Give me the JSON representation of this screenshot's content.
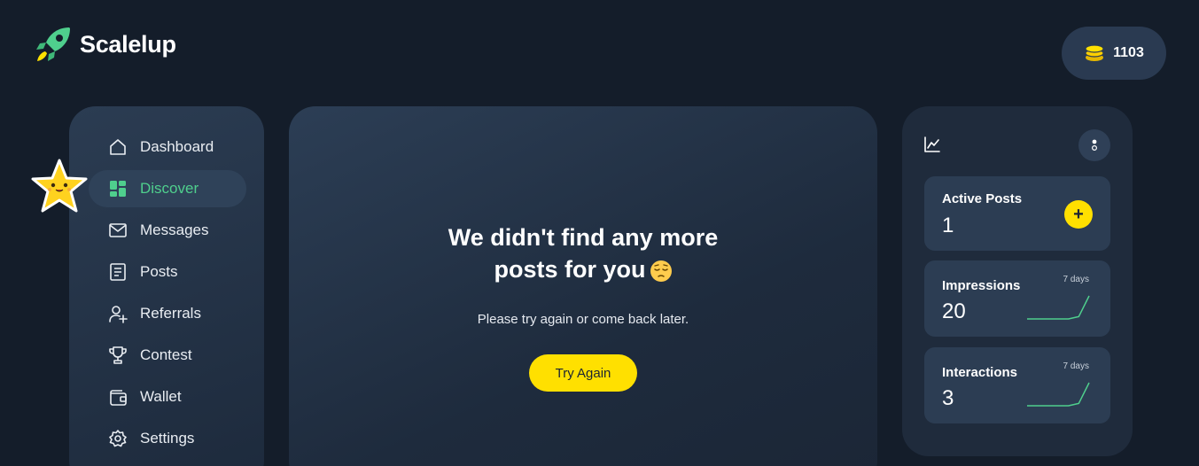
{
  "brand": {
    "name": "Scalelup",
    "logo_icon": "rocket-icon"
  },
  "coins": {
    "icon": "coins-icon",
    "value": "1103"
  },
  "sidebar": {
    "items": [
      {
        "label": "Dashboard",
        "icon": "home-icon",
        "active": false
      },
      {
        "label": "Discover",
        "icon": "dashboard-grid-icon",
        "active": true
      },
      {
        "label": "Messages",
        "icon": "mail-icon",
        "active": false
      },
      {
        "label": "Posts",
        "icon": "document-icon",
        "active": false
      },
      {
        "label": "Referrals",
        "icon": "user-plus-icon",
        "active": false
      },
      {
        "label": "Contest",
        "icon": "trophy-icon",
        "active": false
      },
      {
        "label": "Wallet",
        "icon": "wallet-icon",
        "active": false
      },
      {
        "label": "Settings",
        "icon": "gear-icon",
        "active": false
      }
    ]
  },
  "main": {
    "title_line1": "We didn't find any more",
    "title_line2": "posts for you",
    "title_emoji": "pensive-face-emoji",
    "subtitle": "Please try again or come back later.",
    "button": "Try Again"
  },
  "stats": {
    "header_icon": "line-chart-icon",
    "menu_icon": "more-vertical-icon",
    "cards": [
      {
        "label": "Active Posts",
        "value": "1",
        "action": "+"
      },
      {
        "label": "Impressions",
        "value": "20",
        "period": "7 days",
        "trend": [
          0,
          0,
          0,
          0,
          0,
          0.1,
          1
        ]
      },
      {
        "label": "Interactions",
        "value": "3",
        "period": "7 days",
        "trend": [
          0,
          0,
          0,
          0,
          0,
          0.1,
          1
        ]
      }
    ]
  },
  "colors": {
    "background": "#141d2a",
    "panel": "#2b3c52",
    "accent_green": "#4fcf8d",
    "accent_yellow": "#ffe000"
  }
}
